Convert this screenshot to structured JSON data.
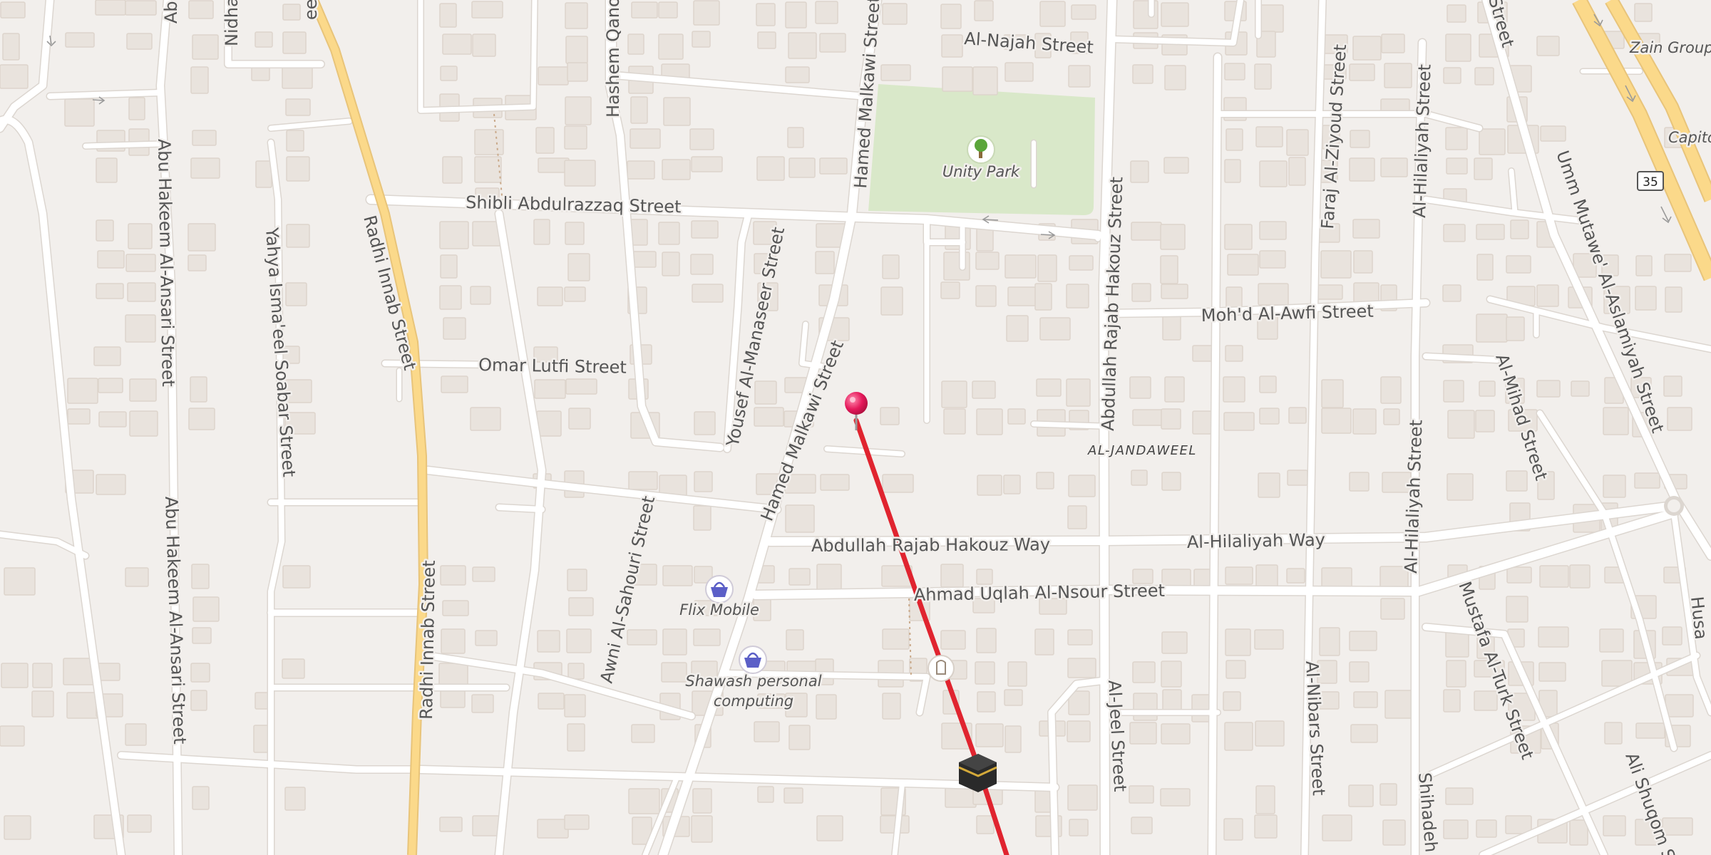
{
  "map": {
    "streets": {
      "al_najah": "Al-Najah Street",
      "hashem_qano": "Hashem Qano",
      "hamed_malkawi_north": "Hamed Malkawi Street",
      "hamed_malkawi_south": "Hamed Malkawi Street",
      "shibli": "Shibli Abdulrazzaq Street",
      "radhi_innab_north": "Radhi Innab Street",
      "radhi_innab_south": "Radhi Innab Street",
      "abu_hakeem_north": "Abu Hakeem Al-Ansari Street",
      "abu_hakeem_south": "Abu Hakeem Al-Ansari Street",
      "yahya": "Yahya Isma'eel Soabar Street",
      "omar_lutfi": "Omar Lutfi Street",
      "yousef": "Yousef Al-Manaseer Street",
      "awni": "Awni Al-Sahouri Street",
      "abdullah_hakouz_street": "Abdullah Rajab Hakouz Street",
      "abdullah_hakouz_way": "Abdullah Rajab Hakouz Way",
      "al_hilaliyah_way": "Al-Hilaliyah Way",
      "ahmad_uqlah": "Ahmad Uqlah Al-Nsour Street",
      "mohd_awfi": "Moh'd Al-Awfi Street",
      "faraj": "Faraj Al-Ziyoud Street",
      "al_hilaliyah_north": "Al-Hilaliyah Street",
      "al_hilaliyah_south": "Al-Hilaliyah Street",
      "umm_mutawe": "Umm Mutawe' Al-Aslamiyah Street",
      "al_mihad": "Al-Mihad Street",
      "mustafa": "Mustafa Al-Turk Street",
      "al_jeel": "Al-Jeel Street",
      "al_nibars": "Al-Nibars Street",
      "shihadeh": "Shihadeh",
      "ali_shuqom": "Ali Shuqom S",
      "husa": "Husa",
      "nidha": "Nidha",
      "top_left_cut": "Ab",
      "top_radhi_cut": "eet",
      "top_right_street": "Street"
    },
    "district": "AL-JANDAWEEL",
    "poi": {
      "park": "Unity Park",
      "flix": "Flix Mobile",
      "shawash_line1": "Shawash personal",
      "shawash_line2": "computing",
      "zain": "Zain Group",
      "capital": "Capito"
    },
    "route_shield": "35",
    "icons": {
      "park": "tree-icon",
      "shop": "shopping-basket-icon",
      "mosque": "kaaba-icon",
      "pin": "location-pin-icon",
      "other": "place-of-worship-icon"
    },
    "colors": {
      "background": "#f2efec",
      "building": "#e9e3dd",
      "road": "#ffffff",
      "highway": "#fbd98a",
      "park": "#d9e8c9",
      "route": "#e0242f",
      "pin": "#e5195b",
      "poi_shop": "#5b5fc7"
    }
  }
}
